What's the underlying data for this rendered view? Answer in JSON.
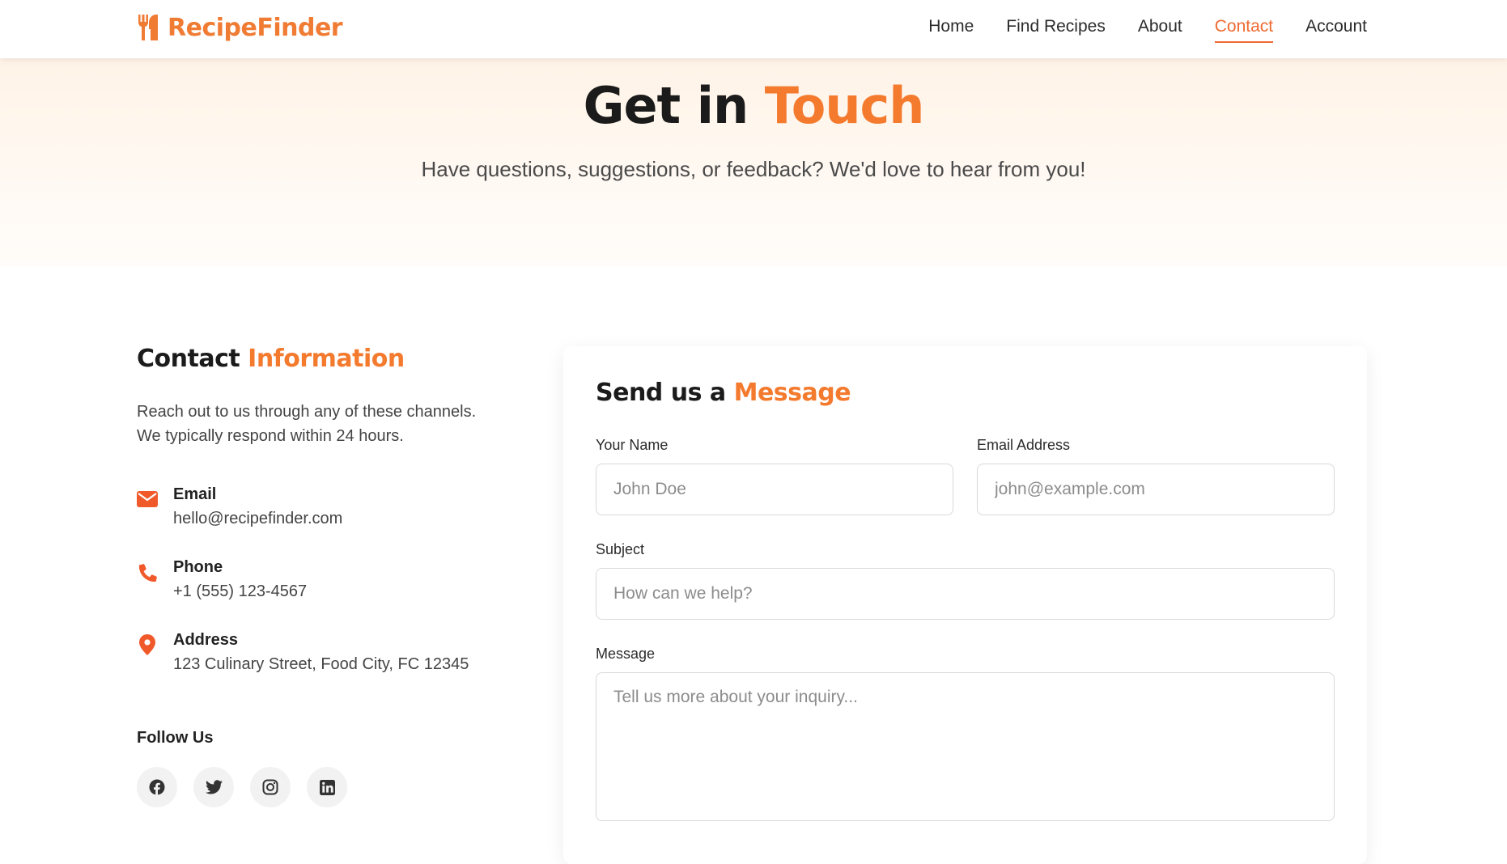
{
  "brand": {
    "name": "RecipeFinder",
    "icon": "utensils-icon",
    "color": "#f07b33"
  },
  "nav": {
    "items": [
      {
        "label": "Home"
      },
      {
        "label": "Find Recipes"
      },
      {
        "label": "About"
      },
      {
        "label": "Contact",
        "active": true
      },
      {
        "label": "Account"
      }
    ]
  },
  "hero": {
    "title_plain": "Get in",
    "title_accent": "Touch",
    "subtitle": "Have questions, suggestions, or feedback? We'd love to hear from you!"
  },
  "contact_info": {
    "heading_plain": "Contact",
    "heading_accent": "Information",
    "intro_line1": "Reach out to us through any of these channels.",
    "intro_line2": "We typically respond within 24 hours.",
    "items": [
      {
        "icon": "envelope-icon",
        "label": "Email",
        "value": "hello@recipefinder.com"
      },
      {
        "icon": "phone-icon",
        "label": "Phone",
        "value": "+1 (555) 123-4567"
      },
      {
        "icon": "map-pin-icon",
        "label": "Address",
        "value": "123 Culinary Street, Food City, FC 12345"
      }
    ],
    "follow_label": "Follow Us",
    "socials": [
      "facebook-icon",
      "twitter-icon",
      "instagram-icon",
      "linkedin-icon"
    ]
  },
  "form": {
    "heading_plain": "Send us a",
    "heading_accent": "Message",
    "name_label": "Your Name",
    "name_placeholder": "John Doe",
    "email_label": "Email Address",
    "email_placeholder": "john@example.com",
    "subject_label": "Subject",
    "subject_placeholder": "How can we help?",
    "message_label": "Message",
    "message_placeholder": "Tell us more about your inquiry..."
  },
  "colors": {
    "accent": "#f47a2e",
    "nav_active": "#f06a32",
    "icon": "#f05a2a"
  }
}
